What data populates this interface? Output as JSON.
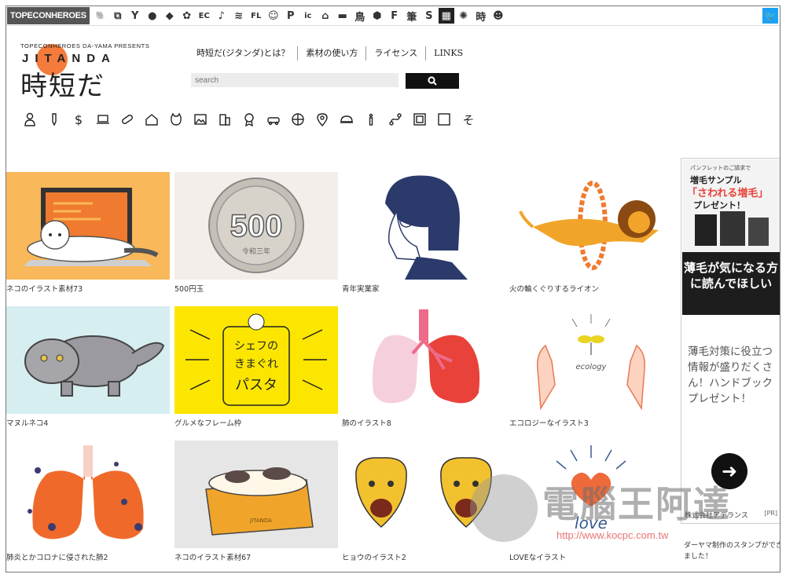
{
  "topbar": {
    "brand": "TOPECONHEROES",
    "site_icons": [
      {
        "name": "elephant-icon",
        "glyph": "🐘"
      },
      {
        "name": "copy-icon",
        "glyph": "⧉"
      },
      {
        "name": "figure-icon",
        "glyph": "Y"
      },
      {
        "name": "speech-icon",
        "glyph": "●"
      },
      {
        "name": "sticker-icon",
        "glyph": "◆"
      },
      {
        "name": "flower-icon",
        "glyph": "✿"
      },
      {
        "name": "ec-label",
        "glyph": "EC"
      },
      {
        "name": "note-icon",
        "glyph": "♪"
      },
      {
        "name": "line-icon",
        "glyph": "≋"
      },
      {
        "name": "flat-icon",
        "glyph": "FL"
      },
      {
        "name": "smile-icon",
        "glyph": "☺"
      },
      {
        "name": "p-icon",
        "glyph": "P"
      },
      {
        "name": "icon-label",
        "glyph": "ic"
      },
      {
        "name": "house-icon",
        "glyph": "⌂"
      },
      {
        "name": "sofa-icon",
        "glyph": "▬"
      },
      {
        "name": "bird-icon",
        "glyph": "鳥"
      },
      {
        "name": "hexagon-icon",
        "glyph": "⬢"
      },
      {
        "name": "f-icon",
        "glyph": "F"
      },
      {
        "name": "brush-icon",
        "glyph": "筆"
      },
      {
        "name": "s-icon",
        "glyph": "S"
      },
      {
        "name": "grid-icon",
        "glyph": "▦"
      },
      {
        "name": "burst-icon",
        "glyph": "✺"
      },
      {
        "name": "time-icon",
        "glyph": "時"
      },
      {
        "name": "face-icon",
        "glyph": "☻"
      }
    ],
    "twitter_glyph": "🐦"
  },
  "logo": {
    "presents": "TOPECONHEROES DA-YAMA PRESENTS",
    "name": "JITANDA",
    "kanji": "時短だ"
  },
  "nav": [
    "時短だ(ジタンダ)とは？",
    "素材の使い方",
    "ライセンス",
    "LINKS"
  ],
  "search": {
    "placeholder": "search"
  },
  "categories": [
    "person-icon",
    "pen-icon",
    "dollar-icon",
    "laptop-icon",
    "pill-icon",
    "house-icon",
    "cat-icon",
    "image-icon",
    "building-icon",
    "medal-icon",
    "car-icon",
    "ball-icon",
    "pin-icon",
    "food-icon",
    "info-icon",
    "route-icon",
    "frame-icon",
    "square-icon",
    "so-icon"
  ],
  "cards": [
    {
      "caption": "ネコのイラスト素材73"
    },
    {
      "caption": "500円玉",
      "coin_text": "500",
      "coin_sub": "令和三年"
    },
    {
      "caption": "青年実業家"
    },
    {
      "caption": "火の輪くぐりするライオン"
    },
    {
      "caption": "マヌルネコ4"
    },
    {
      "caption": "グルメなフレーム枠",
      "frame_text_1": "シェフの",
      "frame_text_2": "きまぐれ",
      "frame_text_3": "パスタ"
    },
    {
      "caption": "肺のイラスト8"
    },
    {
      "caption": "エコロジーなイラスト3",
      "eco_text": "ecology"
    },
    {
      "caption": "肺炎とかコロナに侵された肺2"
    },
    {
      "caption": "ネコのイラスト素材67",
      "box_text": "JITANDA"
    },
    {
      "caption": "ヒョウのイラスト2"
    },
    {
      "caption": "LOVEなイラスト",
      "love_text": "love"
    }
  ],
  "ad": {
    "top_small": "パンフレットのご請求で",
    "top_title": "増毛サンプル",
    "top_red": "「さわれる増毛」",
    "top_gift": "プレゼント！",
    "dark_text": "薄毛が気になる方に読んでほしい",
    "body": "薄毛対策に役立つ情報が盛りだくさん！ハンドブックプレゼント！",
    "sponsor": "株式会社アデランス",
    "pr": "[PR]"
  },
  "below_ad": "ダーヤマ制作のスタンプができました！",
  "watermark": {
    "text": "電腦王阿達",
    "url": "http://www.kocpc.com.tw"
  },
  "colors": {
    "orange": "#f9b85a",
    "yellow": "#fce600",
    "navy": "#2b3a6b",
    "teal_bg": "#d6eef0",
    "red": "#e8423a"
  }
}
